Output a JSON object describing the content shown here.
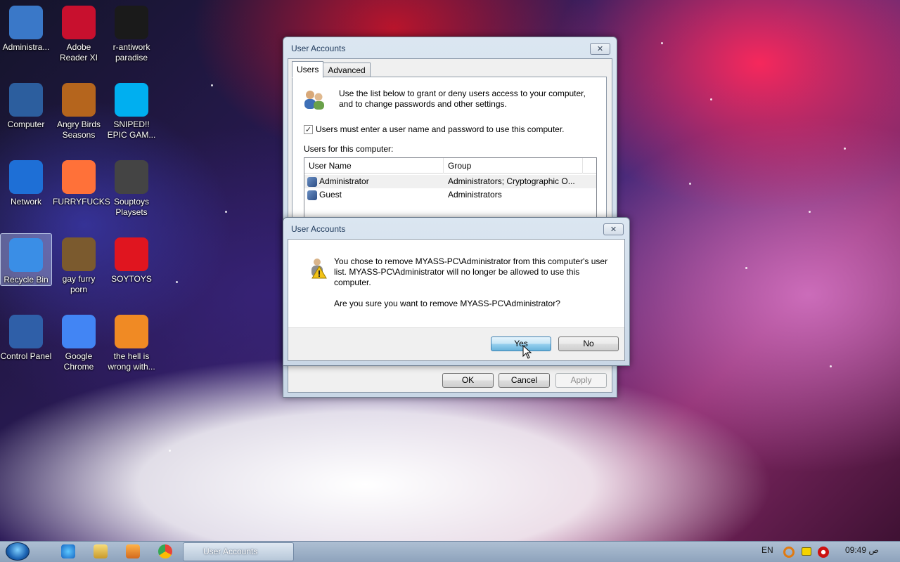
{
  "desktop": {
    "icons": [
      {
        "label": "Administra...",
        "icon": "user-folder-icon",
        "color": "#3a78c8"
      },
      {
        "label": "Adobe Reader XI",
        "icon": "adobe-reader-icon",
        "color": "#c8102e"
      },
      {
        "label": "r-antiwork paradise",
        "icon": "r-antiwork-icon",
        "color": "#1a1a1a"
      },
      {
        "label": "Computer",
        "icon": "computer-icon",
        "color": "#2c5e9e"
      },
      {
        "label": "Angry Birds Seasons",
        "icon": "angry-birds-icon",
        "color": "#b5651d"
      },
      {
        "label": "SNIPED!! EPIC GAM...",
        "icon": "skype-icon",
        "color": "#00aff0"
      },
      {
        "label": "Network",
        "icon": "network-icon",
        "color": "#1e6fd6"
      },
      {
        "label": "FURRYFUCKS",
        "icon": "firefox-icon",
        "color": "#ff7139"
      },
      {
        "label": "Souptoys Playsets",
        "icon": "souptoys-icon",
        "color": "#444444"
      },
      {
        "label": "Recycle Bin",
        "icon": "recycle-bin-icon",
        "color": "#3a8ee6"
      },
      {
        "label": "gay furry porn",
        "icon": "box-bear-icon",
        "color": "#7b5a2e"
      },
      {
        "label": "SOYTOYS",
        "icon": "soytoys-icon",
        "color": "#e0151f"
      },
      {
        "label": "Control Panel",
        "icon": "control-panel-icon",
        "color": "#2f5fa8"
      },
      {
        "label": "Google Chrome",
        "icon": "chrome-icon",
        "color": "#4285f4"
      },
      {
        "label": "the hell is wrong with...",
        "icon": "uc-browser-icon",
        "color": "#f08a24"
      }
    ]
  },
  "parent_window": {
    "title": "User Accounts",
    "tabs": [
      "Users",
      "Advanced"
    ],
    "description": "Use the list below to grant or deny users access to your computer, and to change passwords and other settings.",
    "checkbox_label": "Users must enter a user name and password to use this computer.",
    "checkbox_checked": "✓",
    "list_title": "Users for this computer:",
    "columns": [
      "User Name",
      "Group"
    ],
    "rows": [
      {
        "name": "Administrator",
        "group": "Administrators; Cryptographic O..."
      },
      {
        "name": "Guest",
        "group": "Administrators"
      }
    ],
    "buttons": {
      "ok": "OK",
      "cancel": "Cancel",
      "apply": "Apply"
    }
  },
  "dialog": {
    "title": "User Accounts",
    "message": "You chose to remove MYASS-PC\\Administrator from this computer's user list. MYASS-PC\\Administrator will no longer be allowed to use this computer.",
    "question": "Are you sure you want to remove MYASS-PC\\Administrator?",
    "buttons": {
      "yes": "Yes",
      "no": "No"
    }
  },
  "taskbar": {
    "active_task": "User Accounts",
    "language": "EN",
    "clock": "09:49 ص"
  }
}
